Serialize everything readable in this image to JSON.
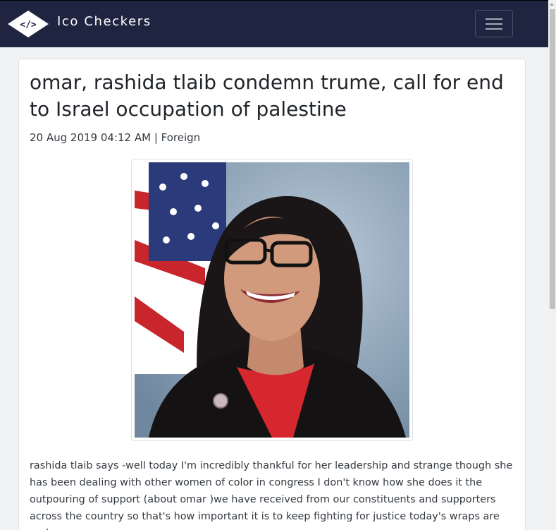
{
  "navbar": {
    "brand": "Ico Checkers",
    "logo_icon": "diamond-code-logo",
    "toggle_icon": "hamburger-menu-icon",
    "background": "#1f2541"
  },
  "article": {
    "title": "omar, rashida tlaib condemn trume, call for end to Israel occupation of palestine",
    "meta": "20 Aug 2019 04:12 AM | Foreign",
    "image_alt": "portrait photo",
    "body": "rashida tlaib says -well today I'm incredibly thankful for her leadership and strange though she has been dealing with other women of color in congress I don't know how she does it the outpouring of support (about omar )we have received from our constituents and supporters across the country so that's how important it is to keep fighting for justice today's wraps are and"
  }
}
